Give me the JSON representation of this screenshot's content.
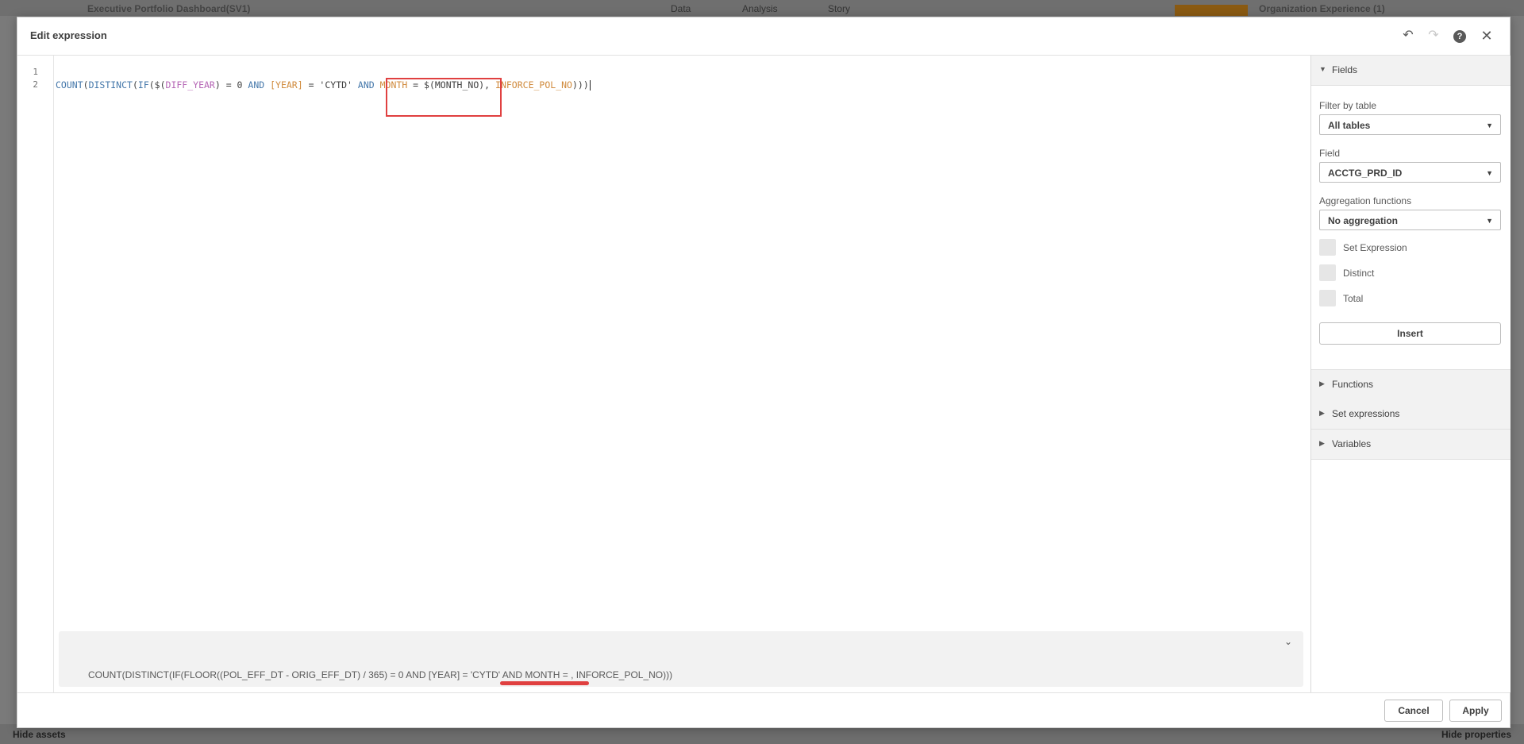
{
  "background": {
    "app_title": "Executive Portfolio Dashboard(SV1)",
    "tabs": [
      "Data",
      "Analysis",
      "Story"
    ],
    "sheet_name": "Organization Experience (1)",
    "hide_assets": "Hide assets",
    "hide_properties": "Hide properties"
  },
  "modal": {
    "title": "Edit expression",
    "icons": {
      "undo": "undo-icon",
      "redo": "redo-icon",
      "help": "?",
      "close": "close-icon"
    }
  },
  "editor": {
    "line_numbers": [
      "1",
      "2"
    ],
    "code_tokens": [
      {
        "t": "COUNT",
        "c": "fn"
      },
      {
        "t": "(",
        "c": "plain"
      },
      {
        "t": "DISTINCT",
        "c": "fn"
      },
      {
        "t": "(",
        "c": "plain"
      },
      {
        "t": "IF",
        "c": "fn"
      },
      {
        "t": "($(",
        "c": "plain"
      },
      {
        "t": "DIFF_YEAR",
        "c": "var"
      },
      {
        "t": ") = 0 ",
        "c": "plain"
      },
      {
        "t": "AND",
        "c": "kw"
      },
      {
        "t": " ",
        "c": "plain"
      },
      {
        "t": "[YEAR]",
        "c": "fld"
      },
      {
        "t": " = 'CYTD' ",
        "c": "plain"
      },
      {
        "t": "AND",
        "c": "kw"
      },
      {
        "t": " ",
        "c": "plain"
      },
      {
        "t": "MONTH",
        "c": "fld"
      },
      {
        "t": " = $(MONTH_NO), ",
        "c": "plain"
      },
      {
        "t": "INFORCE_POL_NO",
        "c": "fld"
      },
      {
        "t": ")))",
        "c": "plain"
      }
    ],
    "preview_text": "COUNT(DISTINCT(IF(FLOOR((POL_EFF_DT - ORIG_EFF_DT) / 365) = 0 AND [YEAR] = 'CYTD' AND MONTH = , INFORCE_POL_NO)))",
    "preview_toggle_icon": "chevron-down-icon"
  },
  "panel": {
    "fields_section": "Fields",
    "filter_label": "Filter by table",
    "filter_value": "All tables",
    "field_label": "Field",
    "field_value": "ACCTG_PRD_ID",
    "agg_label": "Aggregation functions",
    "agg_value": "No aggregation",
    "checkboxes": [
      "Set Expression",
      "Distinct",
      "Total"
    ],
    "insert_label": "Insert",
    "collapsed_sections": [
      "Functions",
      "Set expressions",
      "Variables"
    ]
  },
  "footer": {
    "cancel_label": "Cancel",
    "apply_label": "Apply"
  },
  "colors": {
    "function": "#4477aa",
    "variable": "#b565b5",
    "field": "#d08a3c",
    "annotation": "#e04040"
  }
}
